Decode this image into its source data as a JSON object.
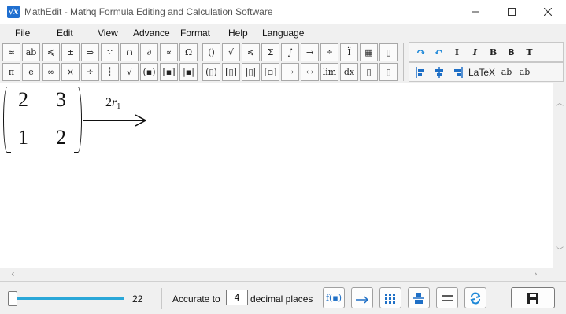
{
  "window": {
    "title": "MathEdit - Mathq Formula Editing and Calculation Software",
    "icon": "sqrt-x-app-icon"
  },
  "menu": {
    "items": [
      "File",
      "Edit",
      "View",
      "Advance",
      "Format",
      "Help",
      "Language"
    ]
  },
  "toolbar": {
    "row1": [
      "≈",
      "ab",
      "≼",
      "±",
      "⇒",
      "∵",
      "∩",
      "∂",
      "∝",
      "Ω",
      "()",
      "√",
      "≼",
      "Σ",
      "∫",
      "→",
      "÷",
      "Ï",
      "▦",
      "▯"
    ],
    "row2": [
      "π",
      "e",
      "∞",
      "×",
      "÷",
      "┆",
      "√",
      "(▪)",
      "[▪]",
      "|▪|",
      "(▯)",
      "[▯]",
      "|▯|",
      "[▫]",
      "→",
      "↔",
      "lim",
      "dx",
      "▯",
      "▯"
    ],
    "right_row1": [
      "redo-icon",
      "undo-icon",
      "I",
      "I",
      "B",
      "B",
      "T"
    ],
    "right_row2": [
      "align-left-icon",
      "align-center-icon",
      "align-right-icon",
      "LaTeX",
      "ab",
      "ab"
    ]
  },
  "editor": {
    "matrix": [
      [
        "2",
        "3"
      ],
      [
        "1",
        "2"
      ]
    ],
    "row_operation": {
      "coefficient": "2",
      "variable": "r",
      "subscript": "1"
    }
  },
  "status": {
    "zoom_value": "22",
    "zoom_fraction": 0.0,
    "accuracy_label": "Accurate to",
    "decimal_places": "4",
    "accuracy_suffix": "decimal places",
    "function_button": "f(▪)"
  },
  "colors": {
    "accent": "#2aa7d8",
    "button_icon_blue": "#1e6fc6",
    "title_bar": "#ffffff",
    "chrome": "#f0f0f0"
  }
}
